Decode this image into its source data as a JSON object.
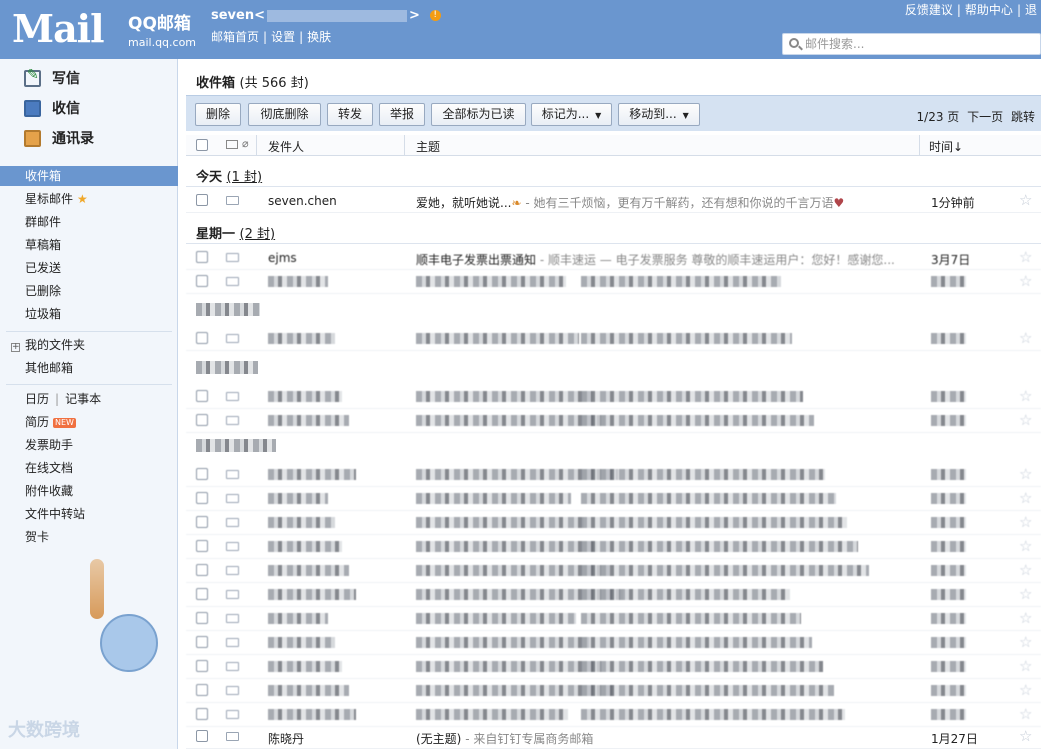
{
  "header": {
    "logo_text": "Mail",
    "brand_title": "QQ邮箱",
    "brand_domain": "mail.qq.com",
    "user_name": "seven<",
    "user_name_end": ">",
    "user_links": [
      "邮箱首页",
      "设置",
      "换肤"
    ],
    "top_links": [
      "反馈建议",
      "帮助中心",
      "退"
    ],
    "search_placeholder": "邮件搜索..."
  },
  "sidebar": {
    "actions": [
      {
        "label": "写信",
        "icon": "compose-icon"
      },
      {
        "label": "收信",
        "icon": "inbox-icon"
      },
      {
        "label": "通讯录",
        "icon": "contacts-icon"
      }
    ],
    "folders": [
      "收件箱",
      "星标邮件",
      "群邮件",
      "草稿箱",
      "已发送",
      "已删除",
      "垃圾箱"
    ],
    "my_folders": "我的文件夹",
    "other_mailbox": "其他邮箱",
    "calendar": "日历",
    "notes": "记事本",
    "tools": [
      "简历",
      "发票助手",
      "在线文档",
      "附件收藏",
      "文件中转站",
      "贺卡"
    ],
    "new_badge": "NEW",
    "watermark": "大数跨境"
  },
  "main": {
    "title": "收件箱",
    "count": "(共 566 封)",
    "toolbar": {
      "delete": "删除",
      "perm_delete": "彻底删除",
      "forward": "转发",
      "report": "举报",
      "mark_all_read": "全部标为已读",
      "mark_as": "标记为...",
      "move_to": "移动到..."
    },
    "pager": {
      "page": "1/23 页",
      "next": "下一页",
      "jump": "跳转"
    },
    "columns": {
      "sender": "发件人",
      "subject": "主题",
      "time": "时间↓"
    },
    "groups": {
      "today": {
        "label": "今天",
        "count": "(1 封)"
      },
      "monday": {
        "label": "星期一",
        "count": "(2 封)"
      }
    },
    "rows": {
      "r1": {
        "sender": "seven.chen",
        "subject": "爱她，就听她说...",
        "preview": " - 她有三千烦恼，更有万千解药，还有想和你说的千言万语",
        "time": "1分钟前"
      },
      "r2": {
        "sender": "ejms",
        "subject": "顺丰电子发票出票通知",
        "preview": " - 顺丰速运 — 电子发票服务 尊敬的顺丰速运用户：您好！感谢您...",
        "time": "3月7日"
      },
      "last": {
        "sender": "陈晓丹",
        "subject": "(无主题)",
        "preview": " - 来自钉钉专属商务邮箱",
        "time": "1月27日"
      }
    }
  }
}
